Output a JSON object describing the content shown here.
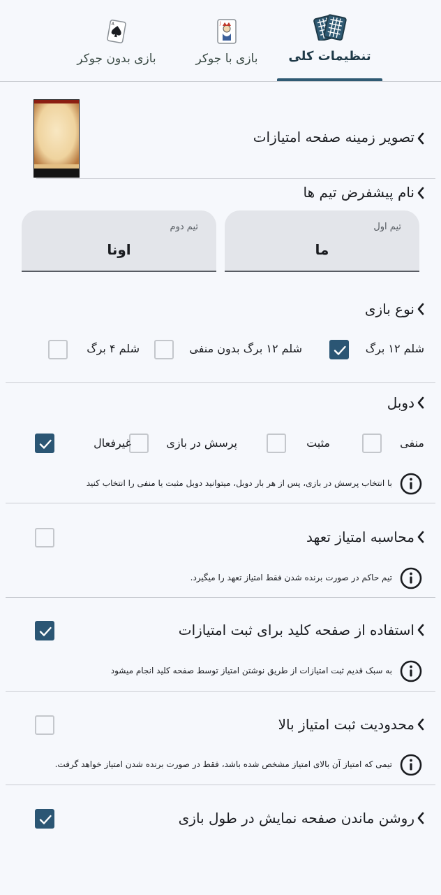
{
  "tabs": [
    {
      "label": "تنظیمات کلی",
      "icon": "playing-cards-icon",
      "active": true
    },
    {
      "label": "بازی با جوکر",
      "icon": "joker-card-icon",
      "active": false
    },
    {
      "label": "بازی بدون جوکر",
      "icon": "ace-of-spades-icon",
      "active": false
    }
  ],
  "background_setting": {
    "title": "تصویر زمینه صفحه امتیازات",
    "thumbnail": "parchment-image"
  },
  "team_names": {
    "title": "نام پیشفرض تیم ها",
    "team1": {
      "label": "تیم اول",
      "value": "ما"
    },
    "team2": {
      "label": "تیم دوم",
      "value": "اونا"
    }
  },
  "game_type": {
    "title": "نوع بازی",
    "options": [
      {
        "label": "شلم ۱۲ برگ",
        "checked": true
      },
      {
        "label": "شلم ۱۲ برگ بدون منفی",
        "checked": false
      },
      {
        "label": "شلم ۴ برگ",
        "checked": false
      }
    ]
  },
  "double": {
    "title": "دوبل",
    "options": [
      {
        "label": "منفی",
        "checked": false
      },
      {
        "label": "مثبت",
        "checked": false
      },
      {
        "label": "پرسش در بازی",
        "checked": false
      },
      {
        "label": "غیرفعال",
        "checked": true
      }
    ],
    "info": "با انتخاب پرسش در بازی، پس از هر بار دوبل، میتوانید دوبل مثبت یا منفی را انتخاب کنید"
  },
  "commitment": {
    "title": "محاسبه امتیاز تعهد",
    "checked": false,
    "info": "تیم حاکم در صورت برنده شدن فقط امتیاز تعهد را میگیرد."
  },
  "keypad": {
    "title": "استفاده از صفحه کلید برای ثبت امتیازات",
    "checked": true,
    "info": "به سبک قدیم ثبت امتیازات از طریق نوشتن امتیاز توسط صفحه کلید انجام میشود"
  },
  "limit": {
    "title": "محدودیت ثبت امتیاز بالا",
    "checked": false,
    "info": "تیمی که امتیاز آن بالای امتیاز مشخص شده باشد، فقط در صورت برنده شدن امتیاز خواهد گرفت."
  },
  "screen_on": {
    "title": "روشن ماندن صفحه نمایش در طول بازی",
    "checked": true
  },
  "colors": {
    "accent": "#2b5674",
    "background": "#f6f8fc",
    "field": "#e3e5ea",
    "divider": "#c9ccd2"
  }
}
